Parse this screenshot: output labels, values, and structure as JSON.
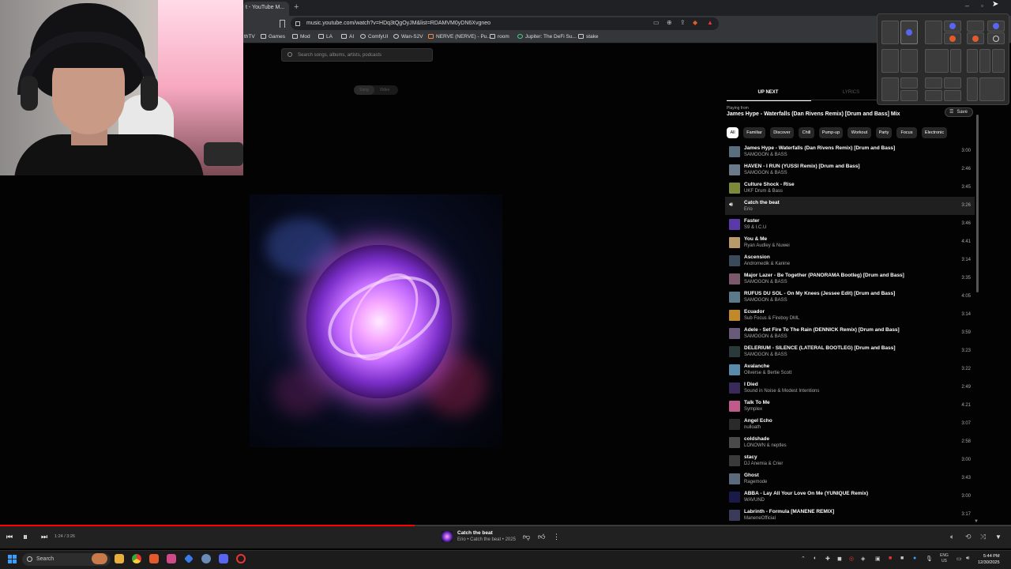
{
  "browser": {
    "tab_title": "t - YouTube M...",
    "url": "music.youtube.com/watch?v=HDq3tQgOyJM&list=RDAMVM0yDN6Xvgneo",
    "bookmarks": [
      "thTV",
      "Games",
      "Mod",
      "LA",
      "AI",
      "ComfyUI",
      "Wan-S2V",
      "NERVE (NERVE) - Pu...",
      "room",
      "Jupiter: The DeFi Su...",
      "stake"
    ]
  },
  "ytmusic": {
    "search_placeholder": "Search songs, albums, artists, podcasts",
    "toggle": [
      "Song",
      "Video"
    ],
    "tabs": {
      "up_next": "UP NEXT",
      "lyrics": "LYRICS"
    },
    "playing_from_label": "Playing from",
    "playing_from": "James Hype - Waterfalls (Dan Rivens Remix) [Drum and Bass] Mix",
    "save_label": "Save",
    "chips": [
      "All",
      "Familiar",
      "Discover",
      "Chill",
      "Pump-up",
      "Workout",
      "Party",
      "Focus",
      "Electronic"
    ],
    "queue": [
      {
        "title": "James Hype - Waterfalls (Dan Rivens Remix) [Drum and Bass]",
        "artist": "SAMOGON & BASS",
        "duration": "3:00",
        "color": "#5a6f7d"
      },
      {
        "title": "HAVEN - I RUN (YUSSI Remix) [Drum and Bass]",
        "artist": "SAMOGON & BASS",
        "duration": "2:46",
        "color": "#6b7a88"
      },
      {
        "title": "Culture Shock - Rise",
        "artist": "UKF Drum & Bass",
        "duration": "3:45",
        "color": "#7a8a3a"
      },
      {
        "title": "Catch the beat",
        "artist": "Erio",
        "duration": "3:26",
        "color": "#1f1f1f"
      },
      {
        "title": "Faster",
        "artist": "S9 & I.C.U",
        "duration": "3:46",
        "color": "#5a3aa8"
      },
      {
        "title": "You & Me",
        "artist": "Ryan Audley & Nuwei",
        "duration": "4:41",
        "color": "#b89a6a"
      },
      {
        "title": "Ascension",
        "artist": "Andromedik & Kanine",
        "duration": "3:14",
        "color": "#3a4a5a"
      },
      {
        "title": "Major Lazer - Be Together (PANORAMA Bootleg) [Drum and Bass]",
        "artist": "SAMOGON & BASS",
        "duration": "3:35",
        "color": "#7a5a6a"
      },
      {
        "title": "RÜFÜS DU SOL - On My Knees (Jessee Edit) [Drum and Bass]",
        "artist": "SAMOGON & BASS",
        "duration": "4:05",
        "color": "#5a7a8a"
      },
      {
        "title": "Ecuador",
        "artist": "Sub Focus & Fireboy DML",
        "duration": "3:14",
        "color": "#c08a2a"
      },
      {
        "title": "Adele - Set Fire To The Rain (DENNICK Remix) [Drum and Bass]",
        "artist": "SAMOGON & BASS",
        "duration": "3:59",
        "color": "#6a5a7a"
      },
      {
        "title": "DELERIUM - SILENCE (LATERAL BOOTLEG) [Drum and Bass]",
        "artist": "SAMOGON & BASS",
        "duration": "3:23",
        "color": "#2a3a3a"
      },
      {
        "title": "Avalanche",
        "artist": "Oliverse & Bertie Scott",
        "duration": "3:22",
        "color": "#5a8aaa"
      },
      {
        "title": "I Died",
        "artist": "Sound in Noise & Modest Intentions",
        "duration": "2:49",
        "color": "#3a2a5a"
      },
      {
        "title": "Talk To Me",
        "artist": "Symplex",
        "duration": "4:21",
        "color": "#c05a8a"
      },
      {
        "title": "Angel Echo",
        "artist": "nulloath",
        "duration": "3:07",
        "color": "#2a2a2a"
      },
      {
        "title": "coldshade",
        "artist": "LONOWN & neptles",
        "duration": "2:58",
        "color": "#4a4a4a"
      },
      {
        "title": "stacy",
        "artist": "DJ Anemia & Crier",
        "duration": "3:00",
        "color": "#3a3a3a"
      },
      {
        "title": "Ghost",
        "artist": "Ragemode",
        "duration": "3:43",
        "color": "#5a6a7a"
      },
      {
        "title": "ABBA - Lay All Your Love On Me (YUNIQUE Remix)",
        "artist": "WAVUND",
        "duration": "3:00",
        "color": "#1a1a4a"
      },
      {
        "title": "Labrinth - Formula [MANENE REMIX]",
        "artist": "ManeneOfficial",
        "duration": "3:17",
        "color": "#3a3a5a"
      }
    ],
    "playing_index": 3
  },
  "player": {
    "time": "1:24 / 3:26",
    "progress_fraction": 0.41,
    "title": "Catch the beat",
    "subtitle": "Erio • Catch the beat • 2025"
  },
  "taskbar": {
    "search_label": "Search",
    "lang": [
      "ENG",
      "US"
    ],
    "time": "5:44 PM",
    "date": "12/30/2025"
  }
}
